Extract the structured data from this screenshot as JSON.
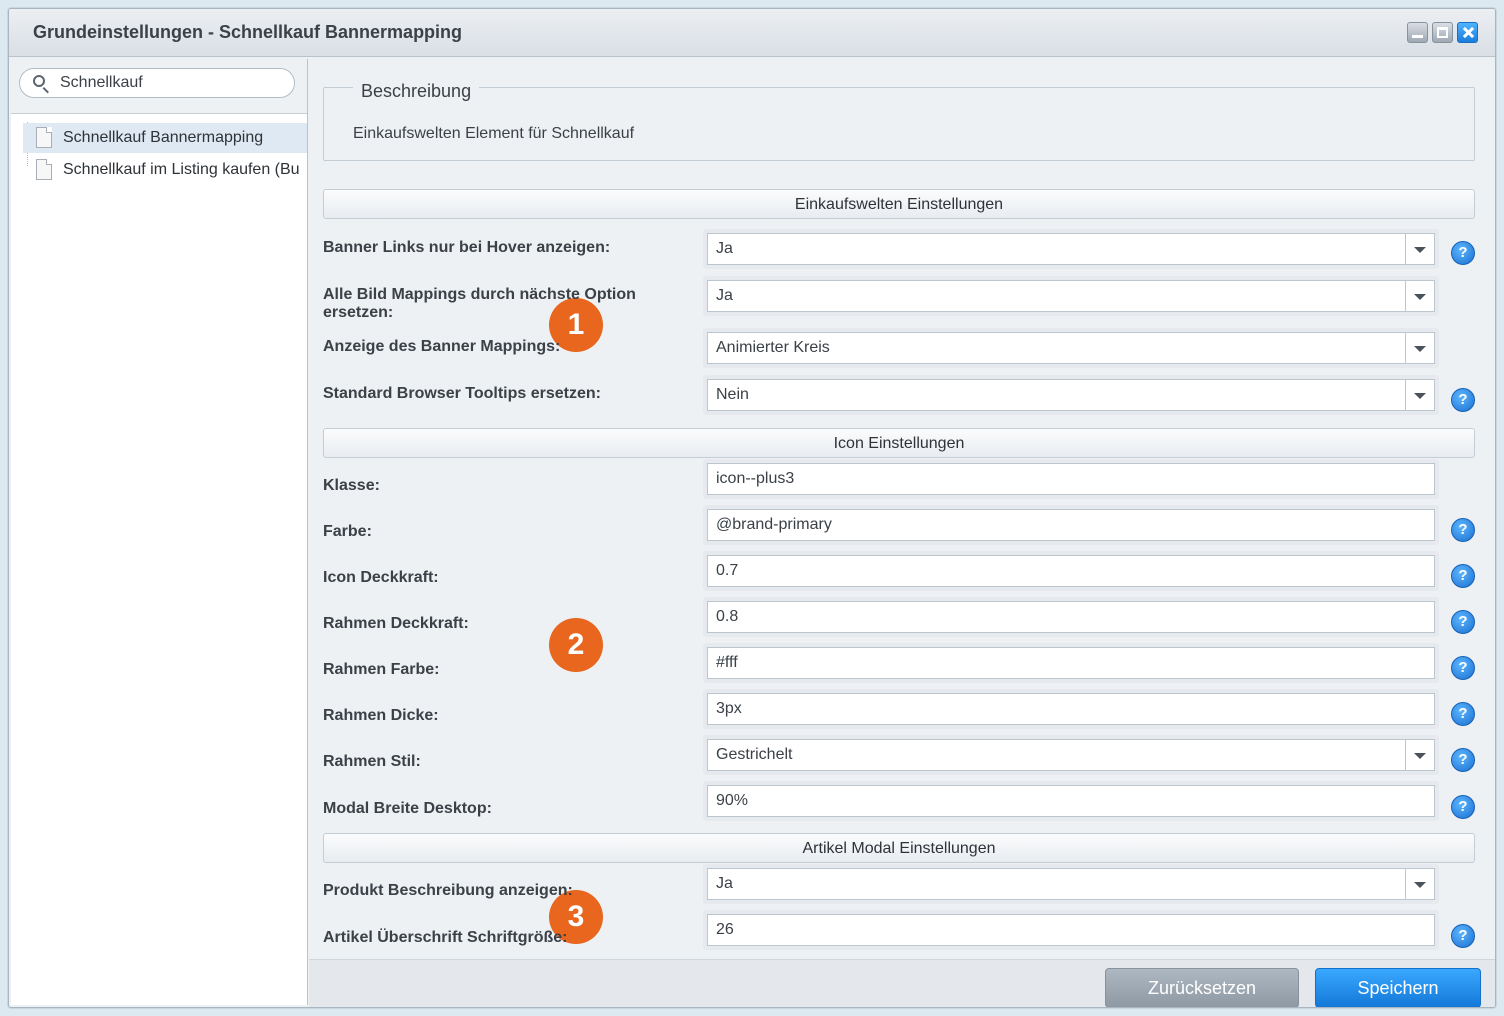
{
  "window": {
    "title": "Grundeinstellungen - Schnellkauf Bannermapping"
  },
  "sidebar": {
    "search": {
      "value": "Schnellkauf"
    },
    "items": [
      {
        "label": "Schnellkauf Bannermapping",
        "selected": true
      },
      {
        "label": "Schnellkauf im Listing kaufen (Bu",
        "selected": false
      }
    ]
  },
  "description": {
    "legend": "Beschreibung",
    "text": "Einkaufswelten Element für Schnellkauf"
  },
  "sections": {
    "einkaufswelten": "Einkaufswelten Einstellungen",
    "icon": "Icon Einstellungen",
    "artikel_modal": "Artikel Modal Einstellungen"
  },
  "fields": {
    "banner_links_hover": {
      "label": "Banner Links nur bei Hover anzeigen:",
      "value": "Ja"
    },
    "alle_bild_mappings": {
      "label": "Alle Bild Mappings durch nächste Option ersetzen:",
      "value": "Ja"
    },
    "anzeige_banner_mappings": {
      "label": "Anzeige des Banner Mappings:",
      "value": "Animierter Kreis"
    },
    "standard_tooltips": {
      "label": "Standard Browser Tooltips ersetzen:",
      "value": "Nein"
    },
    "klasse": {
      "label": "Klasse:",
      "value": "icon--plus3"
    },
    "farbe": {
      "label": "Farbe:",
      "value": "@brand-primary"
    },
    "icon_deckkraft": {
      "label": "Icon Deckkraft:",
      "value": "0.7"
    },
    "rahmen_deckkraft": {
      "label": "Rahmen Deckkraft:",
      "value": "0.8"
    },
    "rahmen_farbe": {
      "label": "Rahmen Farbe:",
      "value": "#fff"
    },
    "rahmen_dicke": {
      "label": "Rahmen Dicke:",
      "value": "3px"
    },
    "rahmen_stil": {
      "label": "Rahmen Stil:",
      "value": "Gestrichelt"
    },
    "modal_breite_desktop": {
      "label": "Modal Breite Desktop:",
      "value": "90%"
    },
    "produkt_beschreibung": {
      "label": "Produkt Beschreibung anzeigen:",
      "value": "Ja"
    },
    "artikel_ueberschrift": {
      "label": "Artikel Überschrift Schriftgröße:",
      "value": "26"
    }
  },
  "help_glyph": "?",
  "badges": [
    "1",
    "2",
    "3"
  ],
  "buttons": {
    "reset": "Zurücksetzen",
    "save": "Speichern"
  },
  "colors": {
    "accent": "#1b7ddb",
    "badge": "#e8661e"
  }
}
